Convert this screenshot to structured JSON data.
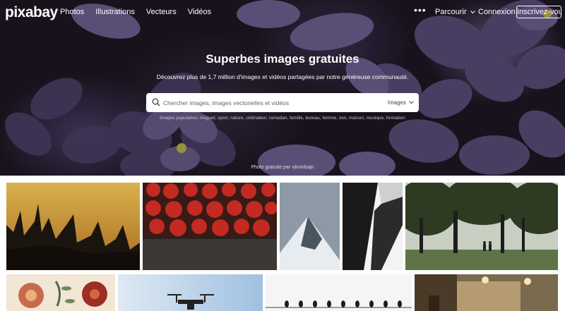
{
  "nav": {
    "logo": "pixabay",
    "links": [
      "Photos",
      "Illustrations",
      "Vecteurs",
      "Vidéos"
    ],
    "more_icon": "more-dots-icon",
    "browse_label": "Parcourir",
    "login_label": "Connexion",
    "signup_label": "Inscrivez-vous"
  },
  "hero": {
    "title": "Superbes images gratuites",
    "subtitle": "Découvrez plus de 1,7 million d'images et vidéos partagées par notre généreuse communauté.",
    "search": {
      "placeholder": "Chercher images, images vectorielles et vidéos",
      "type_label": "Images",
      "icon": "search-icon"
    },
    "popular_prefix": "Images populaires:",
    "popular_tags": [
      "muguet",
      "sport",
      "nature",
      "ordinateur",
      "ramadan",
      "famille",
      "bureau",
      "femme",
      "zen",
      "maison",
      "musique",
      "formation"
    ],
    "credit": "Photo gratuite par vjkombajn"
  },
  "colors": {
    "hero_dark": "#1e1724",
    "petal": "#5b4b7a",
    "white": "#ffffff"
  }
}
